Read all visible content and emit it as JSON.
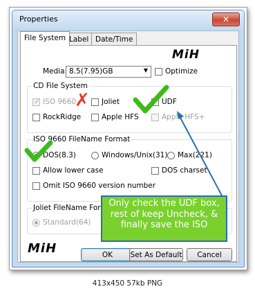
{
  "window": {
    "title": "Properties",
    "close_glyph": "✕"
  },
  "tabs": [
    "File System",
    "Label",
    "Date/Time"
  ],
  "watermark": "MiH",
  "media": {
    "label": "Media:",
    "value": "8.5(7.95)GB",
    "optimize_label": "Optimize"
  },
  "cd_fs": {
    "title": "CD File System",
    "iso9660": "ISO 9660",
    "joliet": "Joliet",
    "udf": "UDF",
    "rockridge": "RockRidge",
    "apple_hfs": "Apple HFS",
    "apple_hfs_plus": "Apple HFS+"
  },
  "iso_format": {
    "title": "ISO 9660 FileName Format",
    "dos": "DOS(8.3)",
    "windows": "Windows/Unix(31)",
    "max": "Max(221)",
    "allow_lower": "Allow lower case",
    "dos_charset": "DOS charset",
    "omit_version": "Omit ISO 9660 version number"
  },
  "joliet_format": {
    "title": "Joliet FileName Format",
    "standard": "Standard(64)"
  },
  "buttons": {
    "ok": "OK",
    "set_default": "Set As Default",
    "cancel": "Cancel"
  },
  "annotation": "Only check the UDF box, rest of keep Uncheck, & finally save the ISO",
  "caption": "413x450 57kb PNG",
  "colors": {
    "annotation_bg": "#7ad12e",
    "annotation_border": "#2b6ea8",
    "checkmark": "#3dbb1c",
    "x_mark": "#e23a2a"
  }
}
